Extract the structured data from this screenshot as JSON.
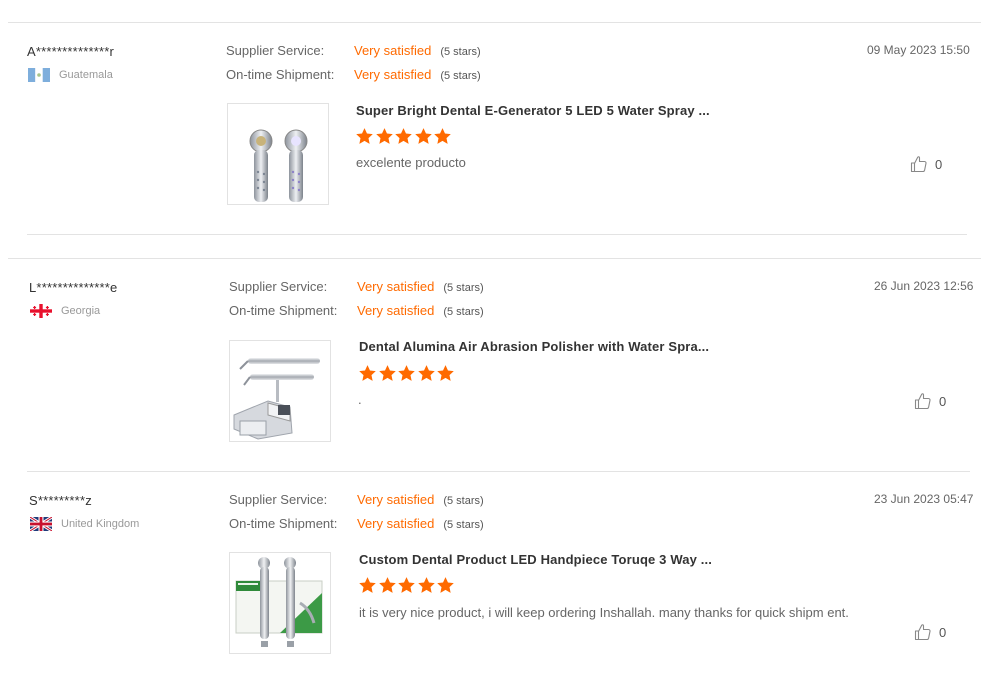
{
  "reviews": [
    {
      "buyer": "A**************r",
      "country": "Guatemala",
      "flag_icon": "guatemala-flag-icon",
      "supplier_label": "Supplier Service:",
      "supplier_value": "Very satisfied",
      "supplier_stars": "(5 stars)",
      "shipment_label": "On-time Shipment:",
      "shipment_value": "Very satisfied",
      "shipment_stars": "(5 stars)",
      "date": "09 May 2023 15:50",
      "product_title": "Super Bright Dental E-Generator 5 LED 5 Water Spray ...",
      "rating": 5,
      "text": "excelente producto",
      "likes": "0"
    },
    {
      "buyer": "L**************e",
      "country": "Georgia",
      "flag_icon": "georgia-flag-icon",
      "supplier_label": "Supplier Service:",
      "supplier_value": "Very satisfied",
      "supplier_stars": "(5 stars)",
      "shipment_label": "On-time Shipment:",
      "shipment_value": "Very satisfied",
      "shipment_stars": "(5 stars)",
      "date": "26 Jun 2023 12:56",
      "product_title": "Dental Alumina Air Abrasion Polisher with Water Spra...",
      "rating": 5,
      "text": ".",
      "likes": "0"
    },
    {
      "buyer": "S*********z",
      "country": "United Kingdom",
      "flag_icon": "uk-flag-icon",
      "supplier_label": "Supplier Service:",
      "supplier_value": "Very satisfied",
      "supplier_stars": "(5 stars)",
      "shipment_label": "On-time Shipment:",
      "shipment_value": "Very satisfied",
      "shipment_stars": "(5 stars)",
      "date": "23 Jun 2023 05:47",
      "product_title": "Custom Dental Product LED Handpiece Toruqe 3 Way ...",
      "rating": 5,
      "text": "it is very nice product, i will keep ordering Inshallah. many thanks for quick shipm ent.",
      "likes": "0"
    }
  ],
  "colors": {
    "accent": "#ff6a00",
    "star": "#ff6a00",
    "divider": "#e3e3e3"
  },
  "icons": {
    "star": "star-icon",
    "like": "thumbs-up-icon"
  }
}
